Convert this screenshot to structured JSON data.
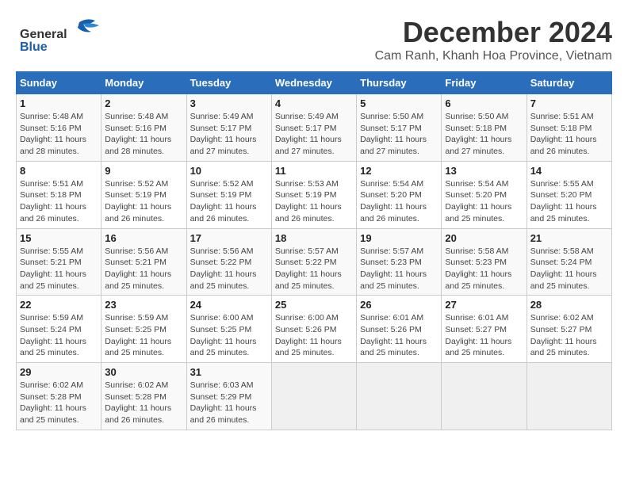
{
  "logo": {
    "general": "General",
    "blue": "Blue"
  },
  "title": "December 2024",
  "subtitle": "Cam Ranh, Khanh Hoa Province, Vietnam",
  "days_of_week": [
    "Sunday",
    "Monday",
    "Tuesday",
    "Wednesday",
    "Thursday",
    "Friday",
    "Saturday"
  ],
  "weeks": [
    [
      {
        "day": "1",
        "info": "Sunrise: 5:48 AM\nSunset: 5:16 PM\nDaylight: 11 hours\nand 28 minutes."
      },
      {
        "day": "2",
        "info": "Sunrise: 5:48 AM\nSunset: 5:16 PM\nDaylight: 11 hours\nand 28 minutes."
      },
      {
        "day": "3",
        "info": "Sunrise: 5:49 AM\nSunset: 5:17 PM\nDaylight: 11 hours\nand 27 minutes."
      },
      {
        "day": "4",
        "info": "Sunrise: 5:49 AM\nSunset: 5:17 PM\nDaylight: 11 hours\nand 27 minutes."
      },
      {
        "day": "5",
        "info": "Sunrise: 5:50 AM\nSunset: 5:17 PM\nDaylight: 11 hours\nand 27 minutes."
      },
      {
        "day": "6",
        "info": "Sunrise: 5:50 AM\nSunset: 5:18 PM\nDaylight: 11 hours\nand 27 minutes."
      },
      {
        "day": "7",
        "info": "Sunrise: 5:51 AM\nSunset: 5:18 PM\nDaylight: 11 hours\nand 26 minutes."
      }
    ],
    [
      {
        "day": "8",
        "info": "Sunrise: 5:51 AM\nSunset: 5:18 PM\nDaylight: 11 hours\nand 26 minutes."
      },
      {
        "day": "9",
        "info": "Sunrise: 5:52 AM\nSunset: 5:19 PM\nDaylight: 11 hours\nand 26 minutes."
      },
      {
        "day": "10",
        "info": "Sunrise: 5:52 AM\nSunset: 5:19 PM\nDaylight: 11 hours\nand 26 minutes."
      },
      {
        "day": "11",
        "info": "Sunrise: 5:53 AM\nSunset: 5:19 PM\nDaylight: 11 hours\nand 26 minutes."
      },
      {
        "day": "12",
        "info": "Sunrise: 5:54 AM\nSunset: 5:20 PM\nDaylight: 11 hours\nand 26 minutes."
      },
      {
        "day": "13",
        "info": "Sunrise: 5:54 AM\nSunset: 5:20 PM\nDaylight: 11 hours\nand 25 minutes."
      },
      {
        "day": "14",
        "info": "Sunrise: 5:55 AM\nSunset: 5:20 PM\nDaylight: 11 hours\nand 25 minutes."
      }
    ],
    [
      {
        "day": "15",
        "info": "Sunrise: 5:55 AM\nSunset: 5:21 PM\nDaylight: 11 hours\nand 25 minutes."
      },
      {
        "day": "16",
        "info": "Sunrise: 5:56 AM\nSunset: 5:21 PM\nDaylight: 11 hours\nand 25 minutes."
      },
      {
        "day": "17",
        "info": "Sunrise: 5:56 AM\nSunset: 5:22 PM\nDaylight: 11 hours\nand 25 minutes."
      },
      {
        "day": "18",
        "info": "Sunrise: 5:57 AM\nSunset: 5:22 PM\nDaylight: 11 hours\nand 25 minutes."
      },
      {
        "day": "19",
        "info": "Sunrise: 5:57 AM\nSunset: 5:23 PM\nDaylight: 11 hours\nand 25 minutes."
      },
      {
        "day": "20",
        "info": "Sunrise: 5:58 AM\nSunset: 5:23 PM\nDaylight: 11 hours\nand 25 minutes."
      },
      {
        "day": "21",
        "info": "Sunrise: 5:58 AM\nSunset: 5:24 PM\nDaylight: 11 hours\nand 25 minutes."
      }
    ],
    [
      {
        "day": "22",
        "info": "Sunrise: 5:59 AM\nSunset: 5:24 PM\nDaylight: 11 hours\nand 25 minutes."
      },
      {
        "day": "23",
        "info": "Sunrise: 5:59 AM\nSunset: 5:25 PM\nDaylight: 11 hours\nand 25 minutes."
      },
      {
        "day": "24",
        "info": "Sunrise: 6:00 AM\nSunset: 5:25 PM\nDaylight: 11 hours\nand 25 minutes."
      },
      {
        "day": "25",
        "info": "Sunrise: 6:00 AM\nSunset: 5:26 PM\nDaylight: 11 hours\nand 25 minutes."
      },
      {
        "day": "26",
        "info": "Sunrise: 6:01 AM\nSunset: 5:26 PM\nDaylight: 11 hours\nand 25 minutes."
      },
      {
        "day": "27",
        "info": "Sunrise: 6:01 AM\nSunset: 5:27 PM\nDaylight: 11 hours\nand 25 minutes."
      },
      {
        "day": "28",
        "info": "Sunrise: 6:02 AM\nSunset: 5:27 PM\nDaylight: 11 hours\nand 25 minutes."
      }
    ],
    [
      {
        "day": "29",
        "info": "Sunrise: 6:02 AM\nSunset: 5:28 PM\nDaylight: 11 hours\nand 25 minutes."
      },
      {
        "day": "30",
        "info": "Sunrise: 6:02 AM\nSunset: 5:28 PM\nDaylight: 11 hours\nand 26 minutes."
      },
      {
        "day": "31",
        "info": "Sunrise: 6:03 AM\nSunset: 5:29 PM\nDaylight: 11 hours\nand 26 minutes."
      },
      {
        "day": "",
        "info": ""
      },
      {
        "day": "",
        "info": ""
      },
      {
        "day": "",
        "info": ""
      },
      {
        "day": "",
        "info": ""
      }
    ]
  ]
}
